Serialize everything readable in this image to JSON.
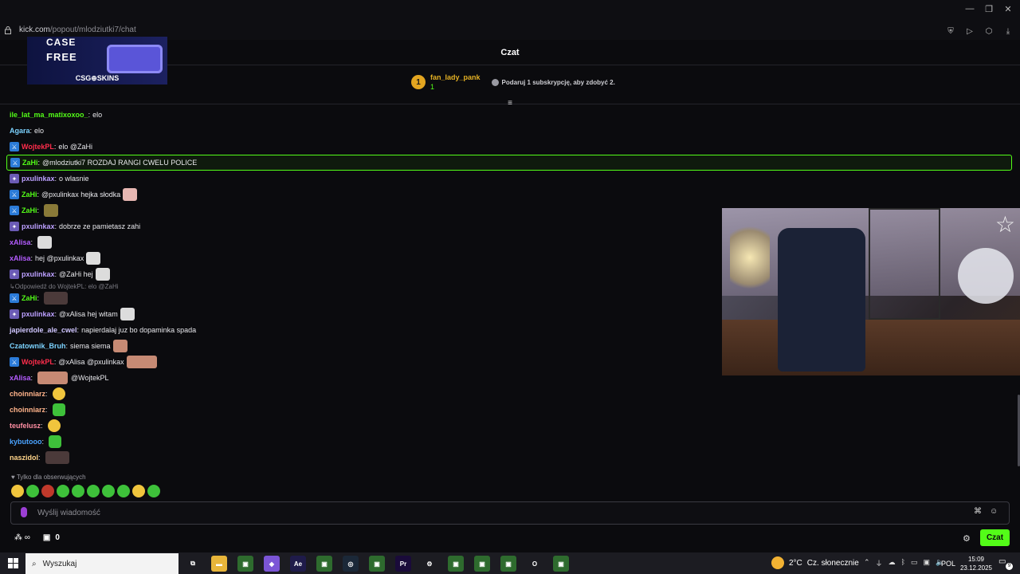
{
  "browser": {
    "url_host": "kick.com",
    "url_path": "/popout/mlodziutki7/chat"
  },
  "ad": {
    "top_text": "CASE",
    "main_text": "FREE",
    "logo_text": "CSG⊕SKINS"
  },
  "chat": {
    "title": "Czat",
    "top_gifter": {
      "rank": "1",
      "username": "fan_lady_pank",
      "count": "1"
    },
    "gift_prompt": "Podaruj 1 subskrypcję, aby zdobyć 2.",
    "messages": [
      {
        "badge": "",
        "user": "ile_lat_ma_matixoxoo_",
        "color": "#53fc18",
        "text": "elo"
      },
      {
        "badge": "",
        "user": "Agara",
        "color": "#7cd3ff",
        "text": "elo"
      },
      {
        "badge": "mod",
        "user": "WojtekPL",
        "color": "#ff2d4b",
        "text": "elo @ZaHi"
      },
      {
        "badge": "mod",
        "user": "ZaHi",
        "color": "#53fc18",
        "text": "@mlodziutki7 ROZDAJ RANGI CWELU POLICE",
        "highlight": true
      },
      {
        "badge": "sub",
        "user": "pxulinkax",
        "color": "#bca0ff",
        "text": "o wlasnie"
      },
      {
        "badge": "mod",
        "user": "ZaHi",
        "color": "#53fc18",
        "text": "@pxulinkax hejka słodka",
        "emote": "pink"
      },
      {
        "badge": "mod",
        "user": "ZaHi",
        "color": "#53fc18",
        "text": "",
        "emote": "olive"
      },
      {
        "badge": "sub",
        "user": "pxulinkax",
        "color": "#bca0ff",
        "text": "dobrze ze pamietasz zahi"
      },
      {
        "badge": "",
        "user": "xAlisa",
        "color": "#b45cff",
        "text": "",
        "emote": "white"
      },
      {
        "badge": "",
        "user": "xAlisa",
        "color": "#b45cff",
        "text": "hej @pxulinkax",
        "emote": "white"
      },
      {
        "badge": "sub",
        "user": "pxulinkax",
        "color": "#bca0ff",
        "text": "@ZaHi hej",
        "emote": "white"
      },
      {
        "reply": "Odpowiedź do WojtekPL: elo @ZaHi"
      },
      {
        "badge": "mod",
        "user": "ZaHi",
        "color": "#53fc18",
        "text": "",
        "emote": "dark-wide"
      },
      {
        "badge": "sub",
        "user": "pxulinkax",
        "color": "#bca0ff",
        "text": "@xAlisa hej witam",
        "emote": "white"
      },
      {
        "badge": "",
        "user": "japierdole_ale_cwel",
        "color": "#d0c6ff",
        "text": "napierdalaj juz bo dopaminka spada"
      },
      {
        "badge": "",
        "user": "Czatownik_Bruh",
        "color": "#7cd3ff",
        "text": "siema siema",
        "emote": "skin"
      },
      {
        "badge": "mod",
        "user": "WojtekPL",
        "color": "#ff2d4b",
        "text": "@xAlisa @pxulinkax",
        "emote": "skin-wide2"
      },
      {
        "badge": "",
        "user": "xAlisa",
        "color": "#b45cff",
        "text": "@WojtekPL",
        "emote_before": "skin-wide2"
      },
      {
        "badge": "",
        "user": "choinniarz",
        "color": "#ffb38a",
        "text": "",
        "emote": "yellow"
      },
      {
        "badge": "",
        "user": "choinniarz",
        "color": "#ffb38a",
        "text": "",
        "emote": "green"
      },
      {
        "badge": "",
        "user": "teufelusz",
        "color": "#ff8fa3",
        "text": "",
        "emote": "yellow"
      },
      {
        "badge": "",
        "user": "kybutooo",
        "color": "#4aa3ff",
        "text": "",
        "emote": "green"
      },
      {
        "badge": "",
        "user": "naszidol",
        "color": "#ffd48a",
        "text": "",
        "emote": "dark-wide"
      }
    ],
    "followers_only": "Tylko dla obserwujących",
    "emote_bar_colors": [
      "#f0c53d",
      "#3ec13a",
      "#c0392b",
      "#3ec13a",
      "#3ec13a",
      "#3ec13a",
      "#3ec13a",
      "#3ec13a",
      "#f0c53d",
      "#3ec13a"
    ],
    "input_placeholder": "Wyślij wiadomość",
    "points": "0",
    "chat_button": "Czat"
  },
  "taskbar": {
    "search_label": "Wyszukaj",
    "apps": [
      "task-view",
      "file-explorer",
      "app",
      "obsidian",
      "after-effects",
      "app",
      "steam",
      "app",
      "premiere",
      "settings",
      "app",
      "app",
      "app",
      "opera",
      "app"
    ],
    "weather_temp": "2°C",
    "weather_desc": "Cz. słonecznie",
    "language": "POL",
    "time": "15:09",
    "date": "23.12.2025",
    "notification_count": "9"
  }
}
